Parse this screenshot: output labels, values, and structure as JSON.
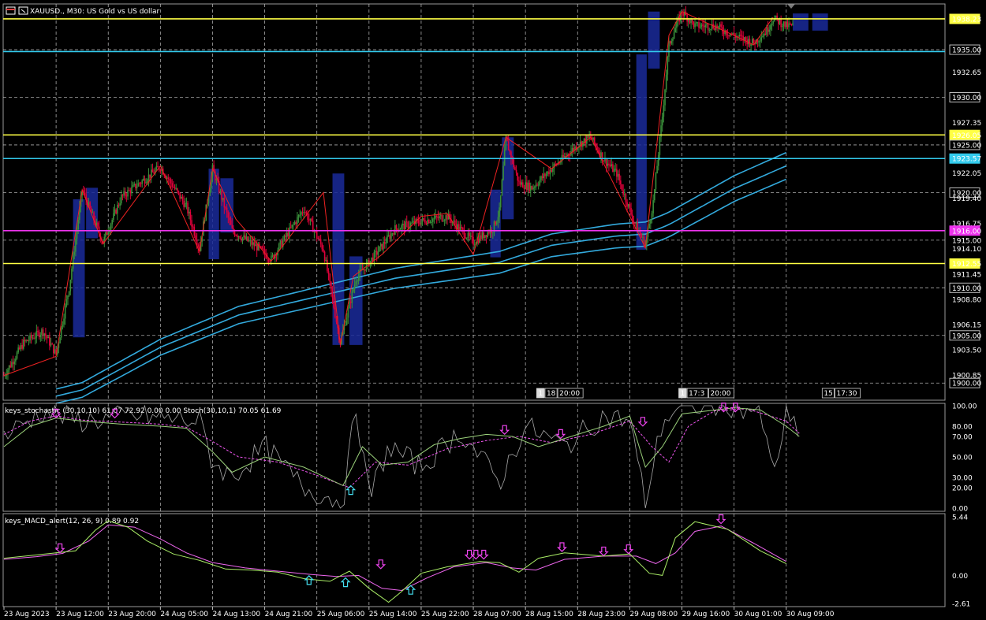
{
  "window": {
    "symbol": "XAUUSD., M30:",
    "description": "US Gold vs US dollar"
  },
  "colors": {
    "background": "#000000",
    "grid": "#c8c8c8",
    "bull": "#3a8f3a",
    "bear": "#e0003a",
    "sr_yellow": "#ffff44",
    "sr_cyan": "#33ccee",
    "sr_magenta": "#ee33ee",
    "ma": "#33aadd",
    "zone": "#1a2a9a",
    "stoch_main": "#9ad07a",
    "stoch_raw": "#a8a8a8",
    "stoch_signal": "#ee55ee",
    "macd": "#aaee66",
    "macd_signal": "#ee66ee"
  },
  "chart_data": [
    {
      "id": "price",
      "type": "candlestick",
      "ylim": [
        1898.2,
        1939.8
      ],
      "y_ticks": [
        "1938.23",
        "1935.00",
        "1932.65",
        "1930.00",
        "1927.35",
        "1926.05",
        "1925.00",
        "1923.57",
        "1922.05",
        "1920.00",
        "1919.40",
        "1916.75",
        "1916.00",
        "1915.00",
        "1914.10",
        "1912.55",
        "1911.45",
        "1910.00",
        "1908.80",
        "1906.15",
        "1905.00",
        "1903.50",
        "1900.85",
        "1900.00"
      ],
      "boxed_ticks": [
        "1938.23",
        "1935.00",
        "1930.00",
        "1926.05",
        "1925.00",
        "1923.57",
        "1920.00",
        "1916.00",
        "1912.55",
        "1910.00",
        "1905.00",
        "1900.00"
      ],
      "levels": [
        {
          "value": 1938.23,
          "color": "yellow"
        },
        {
          "value": 1934.8,
          "color": "cyan"
        },
        {
          "value": 1926.05,
          "color": "yellow"
        },
        {
          "value": 1923.57,
          "color": "cyan"
        },
        {
          "value": 1916.0,
          "color": "magenta"
        },
        {
          "value": 1912.55,
          "color": "yellow"
        }
      ],
      "anchors": [
        [
          0,
          1900.8
        ],
        [
          15,
          1904.2
        ],
        [
          30,
          1905.5
        ],
        [
          40,
          1903.0
        ],
        [
          50,
          1910.0
        ],
        [
          60,
          1920.3
        ],
        [
          70,
          1916.8
        ],
        [
          76,
          1914.8
        ],
        [
          90,
          1919.5
        ],
        [
          120,
          1922.7
        ],
        [
          140,
          1918.5
        ],
        [
          150,
          1914.1
        ],
        [
          160,
          1922.5
        ],
        [
          175,
          1916.0
        ],
        [
          195,
          1914.2
        ],
        [
          205,
          1913.0
        ],
        [
          230,
          1918.3
        ],
        [
          245,
          1914.0
        ],
        [
          258,
          1904.3
        ],
        [
          270,
          1911.0
        ],
        [
          285,
          1913.5
        ],
        [
          300,
          1916.2
        ],
        [
          320,
          1917.0
        ],
        [
          340,
          1917.5
        ],
        [
          360,
          1914.8
        ],
        [
          375,
          1916.2
        ],
        [
          380,
          1918.0
        ],
        [
          385,
          1925.6
        ],
        [
          395,
          1921.0
        ],
        [
          405,
          1920.5
        ],
        [
          420,
          1922.5
        ],
        [
          440,
          1925.0
        ],
        [
          450,
          1925.8
        ],
        [
          460,
          1923.5
        ],
        [
          470,
          1922.0
        ],
        [
          483,
          1917.0
        ],
        [
          492,
          1914.5
        ],
        [
          498,
          1919.0
        ],
        [
          505,
          1928.0
        ],
        [
          510,
          1935.5
        ],
        [
          520,
          1939.0
        ],
        [
          530,
          1937.5
        ],
        [
          545,
          1937.5
        ],
        [
          560,
          1936.5
        ],
        [
          575,
          1935.7
        ],
        [
          585,
          1937.0
        ],
        [
          590,
          1938.3
        ],
        [
          600,
          1937.5
        ]
      ],
      "zones": [
        {
          "i0": 53,
          "i1": 62,
          "top": 1919.3,
          "bottom": 1904.8
        },
        {
          "i0": 63,
          "i1": 72,
          "top": 1920.5,
          "bottom": 1915.2
        },
        {
          "i0": 157,
          "i1": 165,
          "top": 1922.5,
          "bottom": 1913.0
        },
        {
          "i0": 166,
          "i1": 176,
          "top": 1921.5,
          "bottom": 1915.8
        },
        {
          "i0": 252,
          "i1": 261,
          "top": 1922.0,
          "bottom": 1904.0
        },
        {
          "i0": 265,
          "i1": 275,
          "top": 1913.3,
          "bottom": 1904.0
        },
        {
          "i0": 373,
          "i1": 381,
          "top": 1920.3,
          "bottom": 1913.2
        },
        {
          "i0": 382,
          "i1": 391,
          "top": 1925.8,
          "bottom": 1917.2
        },
        {
          "i0": 485,
          "i1": 493,
          "top": 1934.5,
          "bottom": 1914.0
        },
        {
          "i0": 494,
          "i1": 503,
          "top": 1939.0,
          "bottom": 1933.0
        },
        {
          "i0": 605,
          "i1": 617,
          "top": 1938.8,
          "bottom": 1937.0
        },
        {
          "i0": 620,
          "i1": 632,
          "top": 1938.8,
          "bottom": 1937.0
        }
      ],
      "zigzag": [
        [
          0,
          1900.8
        ],
        [
          40,
          1902.8
        ],
        [
          60,
          1920.3
        ],
        [
          76,
          1914.6
        ],
        [
          120,
          1922.8
        ],
        [
          150,
          1913.8
        ],
        [
          160,
          1922.5
        ],
        [
          178,
          1917.2
        ],
        [
          192,
          1915.0
        ],
        [
          205,
          1912.8
        ],
        [
          245,
          1920.0
        ],
        [
          258,
          1904.0
        ],
        [
          268,
          1911.2
        ],
        [
          290,
          1913.5
        ],
        [
          320,
          1917.5
        ],
        [
          340,
          1917.8
        ],
        [
          360,
          1913.5
        ],
        [
          385,
          1925.8
        ],
        [
          420,
          1922.5
        ],
        [
          450,
          1925.8
        ],
        [
          492,
          1914.2
        ],
        [
          510,
          1936.5
        ],
        [
          520,
          1939.0
        ],
        [
          560,
          1936.5
        ],
        [
          575,
          1935.5
        ],
        [
          590,
          1938.4
        ]
      ],
      "ma_series": [
        [
          0,
          1897.5
        ],
        [
          60,
          1899.5
        ],
        [
          120,
          1904.0
        ],
        [
          180,
          1907.4
        ],
        [
          260,
          1910.0
        ],
        [
          300,
          1911.3
        ],
        [
          380,
          1913.0
        ],
        [
          420,
          1914.8
        ],
        [
          470,
          1915.8
        ],
        [
          492,
          1916.0
        ],
        [
          510,
          1917.0
        ],
        [
          560,
          1920.8
        ],
        [
          600,
          1923.2
        ]
      ],
      "ma_offsets": [
        0.5,
        -0.2,
        -0.9
      ],
      "last_index": 605
    },
    {
      "id": "stochastic",
      "type": "line",
      "title": "keys_stochastic (30,10,10) 61.07 72.92 0.00 0.00 Stoch(30,10,1) 70.05 61.69",
      "ylim": [
        0,
        100
      ],
      "y_ticks": [
        "100.00",
        "80.00",
        "70.00",
        "50.00",
        "30.00",
        "20.00",
        "0.00"
      ],
      "main": [
        [
          0,
          60
        ],
        [
          20,
          80
        ],
        [
          40,
          88
        ],
        [
          60,
          85
        ],
        [
          90,
          82
        ],
        [
          120,
          80
        ],
        [
          140,
          78
        ],
        [
          160,
          55
        ],
        [
          175,
          35
        ],
        [
          200,
          50
        ],
        [
          230,
          40
        ],
        [
          260,
          22
        ],
        [
          275,
          60
        ],
        [
          290,
          42
        ],
        [
          310,
          45
        ],
        [
          330,
          62
        ],
        [
          350,
          68
        ],
        [
          370,
          72
        ],
        [
          390,
          70
        ],
        [
          410,
          60
        ],
        [
          430,
          68
        ],
        [
          460,
          80
        ],
        [
          480,
          90
        ],
        [
          492,
          40
        ],
        [
          505,
          60
        ],
        [
          520,
          92
        ],
        [
          540,
          95
        ],
        [
          560,
          98
        ],
        [
          580,
          96
        ],
        [
          600,
          80
        ],
        [
          610,
          70
        ]
      ],
      "signal": [
        [
          0,
          72
        ],
        [
          20,
          85
        ],
        [
          40,
          90
        ],
        [
          60,
          86
        ],
        [
          90,
          84
        ],
        [
          120,
          82
        ],
        [
          140,
          79
        ],
        [
          160,
          65
        ],
        [
          180,
          50
        ],
        [
          210,
          45
        ],
        [
          240,
          32
        ],
        [
          265,
          20
        ],
        [
          285,
          45
        ],
        [
          310,
          42
        ],
        [
          340,
          58
        ],
        [
          370,
          66
        ],
        [
          395,
          70
        ],
        [
          420,
          64
        ],
        [
          450,
          72
        ],
        [
          480,
          85
        ],
        [
          497,
          60
        ],
        [
          510,
          45
        ],
        [
          525,
          80
        ],
        [
          545,
          95
        ],
        [
          570,
          97
        ],
        [
          600,
          85
        ],
        [
          610,
          73
        ]
      ],
      "raw_anchors": [
        [
          0,
          70
        ],
        [
          30,
          95
        ],
        [
          60,
          85
        ],
        [
          100,
          90
        ],
        [
          150,
          85
        ],
        [
          160,
          45
        ],
        [
          175,
          30
        ],
        [
          200,
          60
        ],
        [
          230,
          20
        ],
        [
          260,
          5
        ],
        [
          270,
          100
        ],
        [
          280,
          10
        ],
        [
          295,
          60
        ],
        [
          320,
          40
        ],
        [
          350,
          75
        ],
        [
          380,
          25
        ],
        [
          400,
          80
        ],
        [
          430,
          60
        ],
        [
          460,
          90
        ],
        [
          480,
          85
        ],
        [
          492,
          5
        ],
        [
          505,
          85
        ],
        [
          520,
          100
        ],
        [
          560,
          100
        ],
        [
          580,
          95
        ],
        [
          590,
          30
        ],
        [
          600,
          90
        ],
        [
          610,
          70
        ]
      ],
      "down_arrows": [
        [
          40,
          92
        ],
        [
          85,
          92
        ],
        [
          384,
          76
        ],
        [
          427,
          72
        ],
        [
          490,
          84
        ],
        [
          552,
          98
        ],
        [
          561,
          98
        ]
      ],
      "up_arrows": [
        [
          266,
          18
        ]
      ]
    },
    {
      "id": "macd",
      "type": "line",
      "title": "keys_MACD_alert(12, 26, 9) 0.89 0.92",
      "ylim": [
        -2.9,
        5.75
      ],
      "y_ticks": [
        "5.44",
        "0.00",
        "-2.61"
      ],
      "main": [
        [
          0,
          1.6
        ],
        [
          20,
          1.85
        ],
        [
          40,
          2.1
        ],
        [
          55,
          2.3
        ],
        [
          70,
          4.2
        ],
        [
          80,
          5.1
        ],
        [
          95,
          4.5
        ],
        [
          110,
          3.2
        ],
        [
          130,
          2.0
        ],
        [
          150,
          1.4
        ],
        [
          170,
          0.6
        ],
        [
          190,
          0.5
        ],
        [
          210,
          0.3
        ],
        [
          230,
          -0.3
        ],
        [
          250,
          -0.55
        ],
        [
          265,
          0.4
        ],
        [
          280,
          -1.2
        ],
        [
          295,
          -2.5
        ],
        [
          305,
          -1.5
        ],
        [
          320,
          0.2
        ],
        [
          340,
          0.8
        ],
        [
          365,
          1.3
        ],
        [
          380,
          1.2
        ],
        [
          395,
          0.3
        ],
        [
          410,
          1.6
        ],
        [
          430,
          2.1
        ],
        [
          460,
          1.8
        ],
        [
          480,
          2.0
        ],
        [
          495,
          0.2
        ],
        [
          505,
          0.0
        ],
        [
          515,
          3.5
        ],
        [
          530,
          5.0
        ],
        [
          555,
          4.3
        ],
        [
          580,
          2.3
        ],
        [
          600,
          1.1
        ]
      ],
      "signal": [
        [
          0,
          1.5
        ],
        [
          25,
          1.75
        ],
        [
          45,
          2.05
        ],
        [
          65,
          3.2
        ],
        [
          80,
          4.7
        ],
        [
          100,
          4.5
        ],
        [
          120,
          3.4
        ],
        [
          140,
          2.1
        ],
        [
          160,
          1.2
        ],
        [
          185,
          0.7
        ],
        [
          210,
          0.4
        ],
        [
          235,
          0.1
        ],
        [
          255,
          -0.1
        ],
        [
          272,
          0.0
        ],
        [
          290,
          -1.2
        ],
        [
          305,
          -1.4
        ],
        [
          325,
          -0.2
        ],
        [
          345,
          0.8
        ],
        [
          370,
          1.2
        ],
        [
          390,
          0.7
        ],
        [
          408,
          0.5
        ],
        [
          430,
          1.5
        ],
        [
          460,
          1.8
        ],
        [
          485,
          1.8
        ],
        [
          500,
          1.1
        ],
        [
          515,
          2.1
        ],
        [
          530,
          4.1
        ],
        [
          550,
          4.6
        ],
        [
          575,
          3.0
        ],
        [
          600,
          1.3
        ]
      ],
      "down_arrows": [
        [
          43,
          2.5
        ],
        [
          289,
          1.0
        ],
        [
          357,
          1.9
        ],
        [
          362,
          1.9
        ],
        [
          368,
          1.9
        ],
        [
          428,
          2.6
        ],
        [
          460,
          2.2
        ],
        [
          479,
          2.4
        ],
        [
          550,
          5.2
        ]
      ],
      "up_arrows": [
        [
          234,
          -0.4
        ],
        [
          262,
          -0.6
        ],
        [
          312,
          -1.3
        ]
      ]
    }
  ],
  "time_axis": [
    {
      "index": 0,
      "label": "23 Aug 2023"
    },
    {
      "index": 40,
      "label": "23 Aug 12:00"
    },
    {
      "index": 80,
      "label": "23 Aug 20:00"
    },
    {
      "index": 120,
      "label": "24 Aug 05:00"
    },
    {
      "index": 160,
      "label": "24 Aug 13:00"
    },
    {
      "index": 200,
      "label": "24 Aug 21:00"
    },
    {
      "index": 240,
      "label": "25 Aug 06:00"
    },
    {
      "index": 280,
      "label": "25 Aug 14:00"
    },
    {
      "index": 320,
      "label": "25 Aug 22:00"
    },
    {
      "index": 360,
      "label": "28 Aug 07:00"
    },
    {
      "index": 400,
      "label": "28 Aug 15:00"
    },
    {
      "index": 440,
      "label": "28 Aug 23:00"
    },
    {
      "index": 480,
      "label": "29 Aug 08:00"
    },
    {
      "index": 520,
      "label": "29 Aug 16:00"
    },
    {
      "index": 560,
      "label": "30 Aug 01:00"
    },
    {
      "index": 600,
      "label": "30 Aug 09:00"
    }
  ],
  "time_tags": [
    {
      "index": 411,
      "labels": [
        "1",
        "18",
        "20:00"
      ]
    },
    {
      "index": 520,
      "labels": [
        "1",
        "17:3",
        "20:00"
      ]
    },
    {
      "index": 630,
      "labels": [
        "15",
        "17:30"
      ]
    }
  ]
}
